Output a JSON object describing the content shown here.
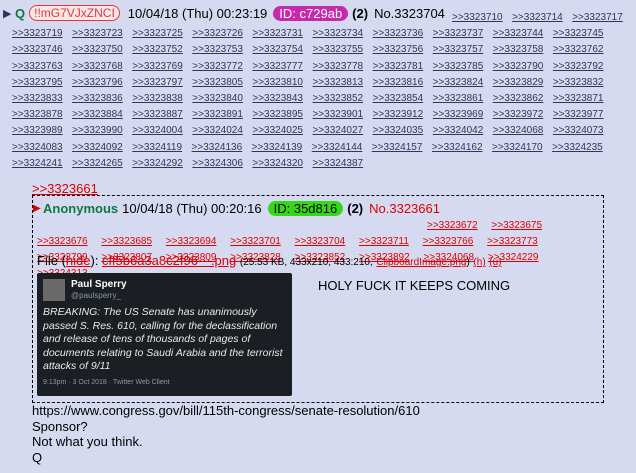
{
  "post": {
    "name": "Q",
    "tripcode": "!!mG7VJxZNCI",
    "date": "10/04/18 (Thu) 00:23:19",
    "id_badge": "ID: c729ab",
    "id_count": "(2)",
    "number": "No.3323704",
    "backlinks": [
      ">>3323710",
      ">>3323714",
      ">>3323717",
      ">>3323719",
      ">>3323723",
      ">>3323725",
      ">>3323726",
      ">>3323731",
      ">>3323734",
      ">>3323736",
      ">>3323737",
      ">>3323744",
      ">>3323745",
      ">>3323746",
      ">>3323750",
      ">>3323752",
      ">>3323753",
      ">>3323754",
      ">>3323755",
      ">>3323756",
      ">>3323757",
      ">>3323758",
      ">>3323762",
      ">>3323763",
      ">>3323768",
      ">>3323769",
      ">>3323772",
      ">>3323777",
      ">>3323778",
      ">>3323781",
      ">>3323785",
      ">>3323790",
      ">>3323792",
      ">>3323795",
      ">>3323796",
      ">>3323797",
      ">>3323805",
      ">>3323810",
      ">>3323813",
      ">>3323816",
      ">>3323824",
      ">>3323829",
      ">>3323832",
      ">>3323833",
      ">>3323836",
      ">>3323838",
      ">>3323840",
      ">>3323843",
      ">>3323852",
      ">>3323854",
      ">>3323861",
      ">>3323862",
      ">>3323871",
      ">>3323878",
      ">>3323884",
      ">>3323887",
      ">>3323891",
      ">>3323895",
      ">>3323901",
      ">>3323912",
      ">>3323969",
      ">>3323972",
      ">>3323977",
      ">>3323989",
      ">>3323990",
      ">>3324004",
      ">>3324024",
      ">>3324025",
      ">>3324027",
      ">>3324035",
      ">>3324042",
      ">>3324068",
      ">>3324073",
      ">>3324083",
      ">>3324092",
      ">>3324119",
      ">>3324136",
      ">>3324139",
      ">>3324144",
      ">>3324157",
      ">>3324162",
      ">>3324170",
      ">>3324235",
      ">>3324241",
      ">>3324265",
      ">>3324292",
      ">>3324306",
      ">>3324320",
      ">>3324387"
    ],
    "quote_link": ">>3323661",
    "body_lines": [
      "https://www.congress.gov/bill/115th-congress/senate-resolution/610",
      "Sponsor?",
      "Not what you think.",
      "Q"
    ]
  },
  "inline_post": {
    "name": "Anonymous",
    "date": "10/04/18 (Thu) 00:20:16",
    "id_badge": "ID: 35d816",
    "id_count": "(2)",
    "number": "No.3323661",
    "backlinks": [
      ">>3323672",
      ">>3323675",
      ">>3323676",
      ">>3323685",
      ">>3323694",
      ">>3323701",
      ">>3323704",
      ">>3323711",
      ">>3323766",
      ">>3323773",
      ">>3323799",
      ">>3323807",
      ">>3323809",
      ">>3323828",
      ">>3323852",
      ">>3323892",
      ">>3324068",
      ">>3324229",
      ">>3324313"
    ],
    "file_label": "File",
    "file_hide": "hide",
    "file_name": "cff5b6a3a8c2f96⋯.png",
    "file_meta": "(25.53 KB, 433x210, 433:210,",
    "file_orig": "ClipboardImage.png",
    "file_h": "(h)",
    "file_u": "(u)",
    "comment": "HOLY FUCK IT KEEPS COMING",
    "thumb": {
      "author": "Paul Sperry",
      "handle": "@paulsperry_",
      "text": "BREAKING: The US Senate has unanimously passed S. Res. 610, calling for the declassification and release of tens of thousands of pages of documents relating to Saudi Arabia and the terrorist attacks of 9/11",
      "footer": "9:13pm · 3 Oct 2018 · Twitter Web Client"
    }
  },
  "colors": {
    "background": "#d6daf0",
    "link": "#34345c",
    "name_green": "#117743",
    "quote_red": "#dd0000",
    "id_q": "#c729ab",
    "id_anon": "#35d816"
  }
}
